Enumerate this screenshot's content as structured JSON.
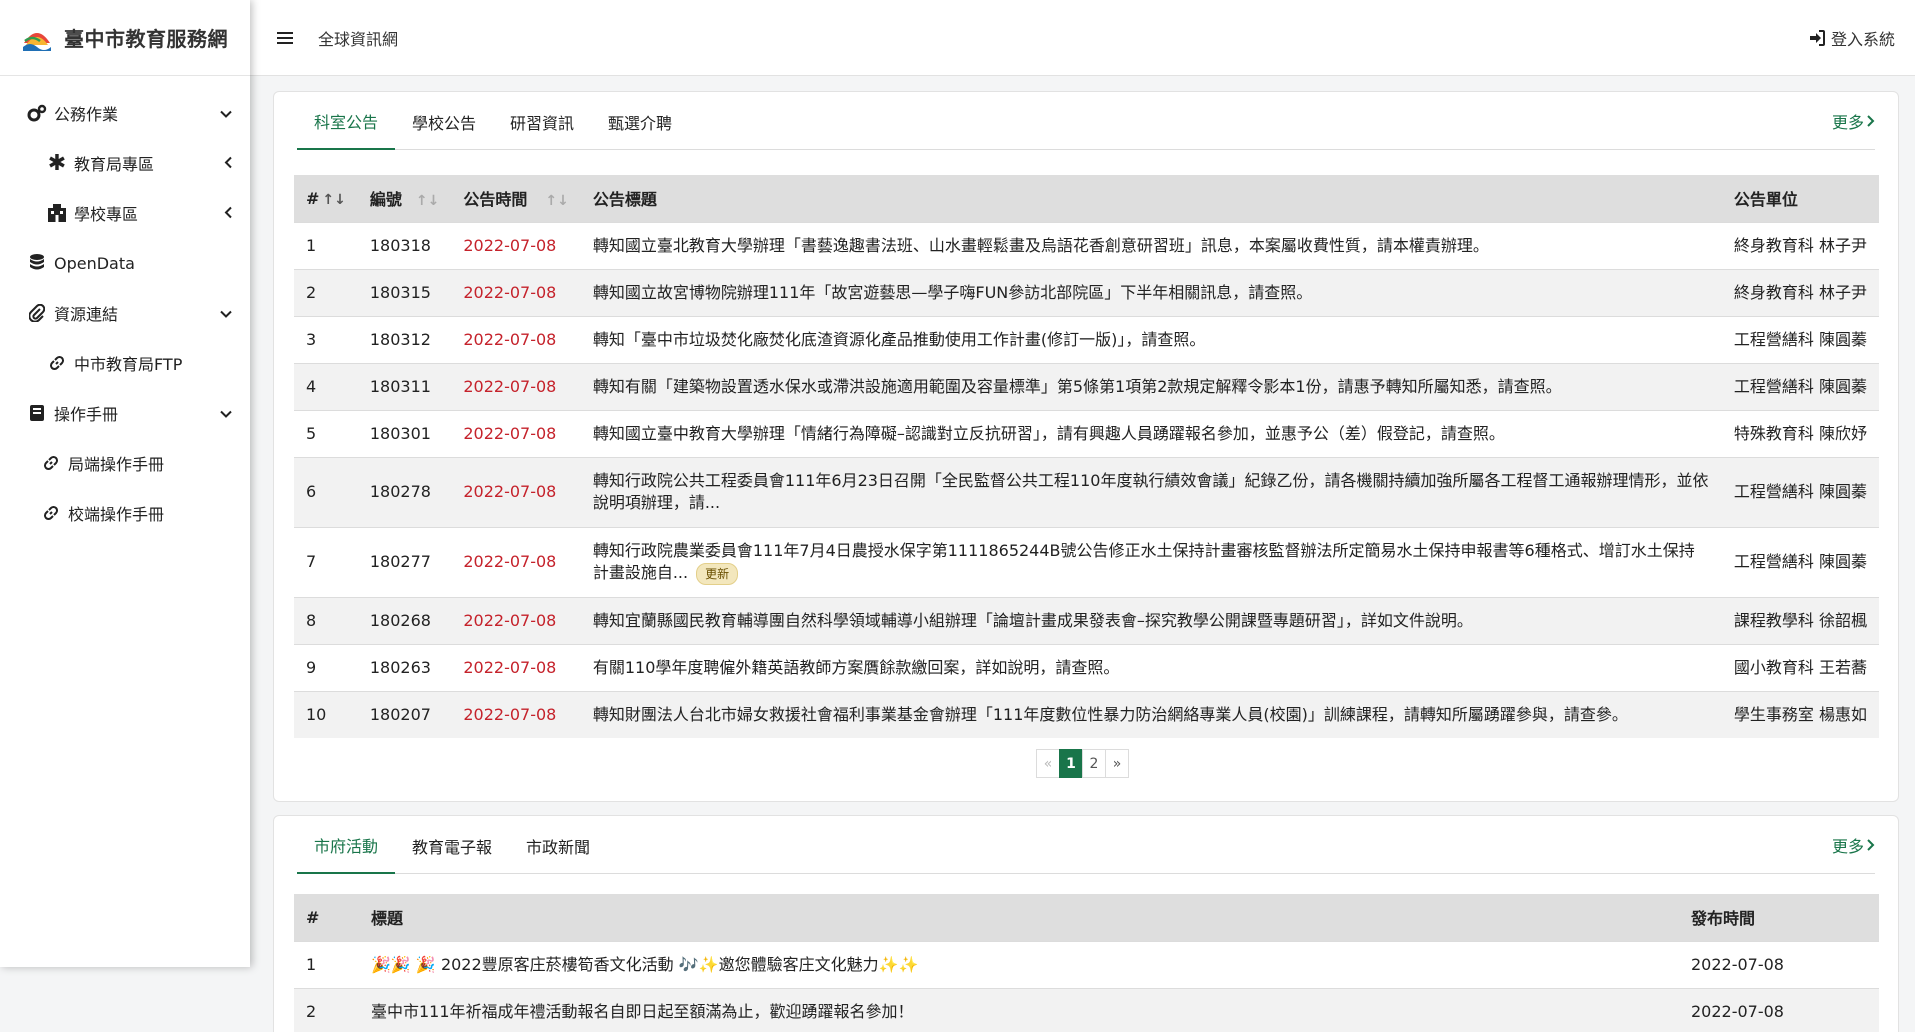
{
  "brand": {
    "title": "臺中市教育服務網",
    "logo": "taichung-edu-logo"
  },
  "sidebar": {
    "items": [
      {
        "label": "公務作業",
        "icon": "gears-icon",
        "caret": "chevron-down"
      },
      {
        "label": "教育局專區",
        "icon": "asterisk-icon",
        "caret": "chevron-left"
      },
      {
        "label": "學校專區",
        "icon": "building-icon",
        "caret": "chevron-left"
      },
      {
        "label": "OpenData",
        "icon": "database-icon"
      },
      {
        "label": "資源連結",
        "icon": "paperclip-icon",
        "caret": "chevron-down"
      },
      {
        "label": "中市教育局FTP",
        "icon": "link-icon"
      },
      {
        "label": "操作手冊",
        "icon": "book-icon",
        "caret": "chevron-down"
      },
      {
        "label": "局端操作手冊",
        "icon": "link-icon"
      },
      {
        "label": "校端操作手冊",
        "icon": "link-icon"
      }
    ]
  },
  "topbar": {
    "link": "全球資訊網",
    "login": "登入系統"
  },
  "announcements": {
    "tabs": [
      "科室公告",
      "學校公告",
      "研習資訊",
      "甄選介聘"
    ],
    "more": "更多",
    "headers": {
      "num": "#",
      "id": "編號",
      "time": "公告時間",
      "title": "公告標題",
      "unit": "公告單位"
    },
    "rows": [
      {
        "num": "1",
        "id": "180318",
        "date": "2022-07-08",
        "title": "轉知國立臺北教育大學辦理「書藝逸趣書法班、山水畫輕鬆畫及烏語花香創意研習班」訊息，本案屬收費性質，請本權責辦理。",
        "unit": "終身教育科 林子尹"
      },
      {
        "num": "2",
        "id": "180315",
        "date": "2022-07-08",
        "title": "轉知國立故宮博物院辦理111年「故宮遊藝思—學子嗨FUN參訪北部院區」下半年相關訊息，請查照。",
        "unit": "終身教育科 林子尹"
      },
      {
        "num": "3",
        "id": "180312",
        "date": "2022-07-08",
        "title": "轉知「臺中市垃圾焚化廠焚化底渣資源化產品推動使用工作計畫(修訂一版)」，請查照。",
        "unit": "工程營繕科 陳圓蓁"
      },
      {
        "num": "4",
        "id": "180311",
        "date": "2022-07-08",
        "title": "轉知有關「建築物設置透水保水或滯洪設施適用範圍及容量標準」第5條第1項第2款規定解釋令影本1份，請惠予轉知所屬知悉，請查照。",
        "unit": "工程營繕科 陳圓蓁"
      },
      {
        "num": "5",
        "id": "180301",
        "date": "2022-07-08",
        "title": "轉知國立臺中教育大學辦理「情緒行為障礙–認識對立反抗研習」，請有興趣人員踴躍報名參加，並惠予公（差）假登記，請查照。",
        "unit": "特殊教育科 陳欣妤"
      },
      {
        "num": "6",
        "id": "180278",
        "date": "2022-07-08",
        "title": "轉知行政院公共工程委員會111年6月23日召開「全民監督公共工程110年度執行績效會議」紀錄乙份，請各機關持續加強所屬各工程督工通報辦理情形，並依說明項辦理，請...",
        "unit": "工程營繕科 陳圓蓁"
      },
      {
        "num": "7",
        "id": "180277",
        "date": "2022-07-08",
        "title": "轉知行政院農業委員會111年7月4日農授水保字第1111865244B號公告修正水土保持計畫審核監督辦法所定簡易水土保持申報書等6種格式、增訂水土保持計畫設施自...",
        "badge": "更新",
        "unit": "工程營繕科 陳圓蓁"
      },
      {
        "num": "8",
        "id": "180268",
        "date": "2022-07-08",
        "title": "轉知宜蘭縣國民教育輔導團自然科學領域輔導小組辦理「論壇計畫成果發表會–探究教學公開課暨專題研習」，詳如文件說明。",
        "unit": "課程教學科 徐韶楓"
      },
      {
        "num": "9",
        "id": "180263",
        "date": "2022-07-08",
        "title": "有關110學年度聘僱外籍英語教師方案贋餘款繳回案，詳如說明，請查照。",
        "unit": "國小教育科 王若蕎"
      },
      {
        "num": "10",
        "id": "180207",
        "date": "2022-07-08",
        "title": "轉知財團法人台北市婦女救援社會福利事業基金會辦理「111年度數位性暴力防治網絡專業人員(校園)」訓練課程，請轉知所屬踴躍參與，請查參。",
        "unit": "學生事務室 楊惠如"
      }
    ],
    "pager": {
      "prev": "«",
      "pages": [
        "1",
        "2"
      ],
      "next": "»",
      "current": "1"
    }
  },
  "news": {
    "tabs": [
      "市府活動",
      "教育電子報",
      "市政新聞"
    ],
    "more": "更多",
    "headers": {
      "num": "#",
      "title": "標題",
      "time": "發布時間"
    },
    "rows": [
      {
        "num": "1",
        "title": "🎉🎉 🎉 2022豐原客庄菸樓筍香文化活動 🎶✨邀您體驗客庄文化魅力✨✨",
        "date": "2022-07-08"
      },
      {
        "num": "2",
        "title": "臺中市111年祈福成年禮活動報名自即日起至額滿為止，歡迎踴躍報名參加！",
        "date": "2022-07-08"
      }
    ]
  },
  "colors": {
    "accent": "#19754a",
    "date": "#c5222b",
    "header_bg": "#dedede"
  }
}
